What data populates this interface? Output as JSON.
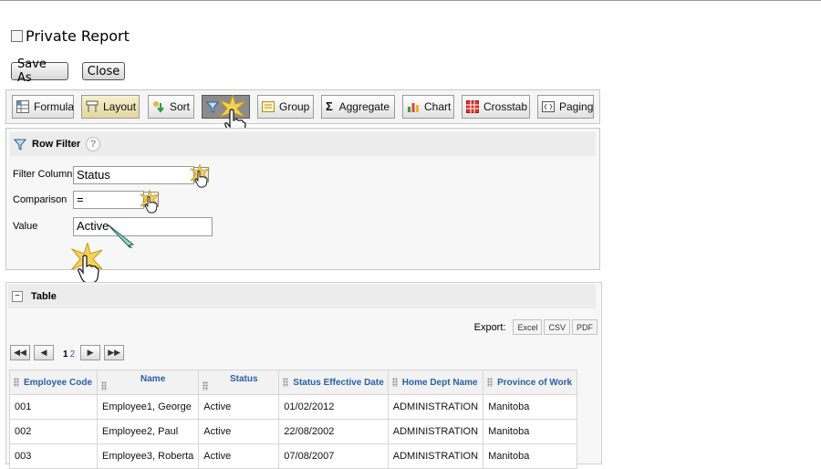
{
  "report": {
    "private_label": "Private Report",
    "save_as_label": "Save As",
    "close_label": "Close"
  },
  "toolbar": {
    "items": [
      {
        "label": "Formula",
        "icon": "formula-icon"
      },
      {
        "label": "Layout",
        "icon": "layout-icon"
      },
      {
        "label": "Sort",
        "icon": "sort-icon"
      },
      {
        "label": "",
        "icon": "filter-icon"
      },
      {
        "label": "Group",
        "icon": "group-icon"
      },
      {
        "label": "Aggregate",
        "icon": "sigma-icon"
      },
      {
        "label": "Chart",
        "icon": "bar-chart-icon"
      },
      {
        "label": "Crosstab",
        "icon": "crosstab-icon"
      },
      {
        "label": "Paging",
        "icon": "paging-icon"
      }
    ]
  },
  "row_filter": {
    "title": "Row Filter",
    "help": "?",
    "filter_column_label": "Filter Column",
    "filter_column_value": "Status",
    "comparison_label": "Comparison",
    "comparison_value": "=",
    "value_label": "Value",
    "value_value": "Active"
  },
  "table_panel": {
    "title": "Table",
    "collapse": "−",
    "export_label": "Export:",
    "export_buttons": [
      "Excel",
      "CSV",
      "PDF"
    ],
    "pages": {
      "current": "1",
      "other": "2"
    },
    "columns": [
      "Employee Code",
      "Name",
      "Status",
      "Status Effective Date",
      "Home Dept Name",
      "Province of Work"
    ],
    "rows": [
      [
        "001",
        "Employee1, George",
        "Active",
        "01/02/2012",
        "ADMINISTRATION",
        "Manitoba"
      ],
      [
        "002",
        "Employee2, Paul",
        "Active",
        "22/08/2002",
        "ADMINISTRATION",
        "Manitoba"
      ],
      [
        "003",
        "Employee3, Roberta",
        "Active",
        "07/08/2007",
        "ADMINISTRATION",
        "Manitoba"
      ]
    ]
  },
  "colors": {
    "header_link": "#2a5fa8",
    "active_tool": "#8c8c8c",
    "panel_bg": "#f7f7f7"
  }
}
